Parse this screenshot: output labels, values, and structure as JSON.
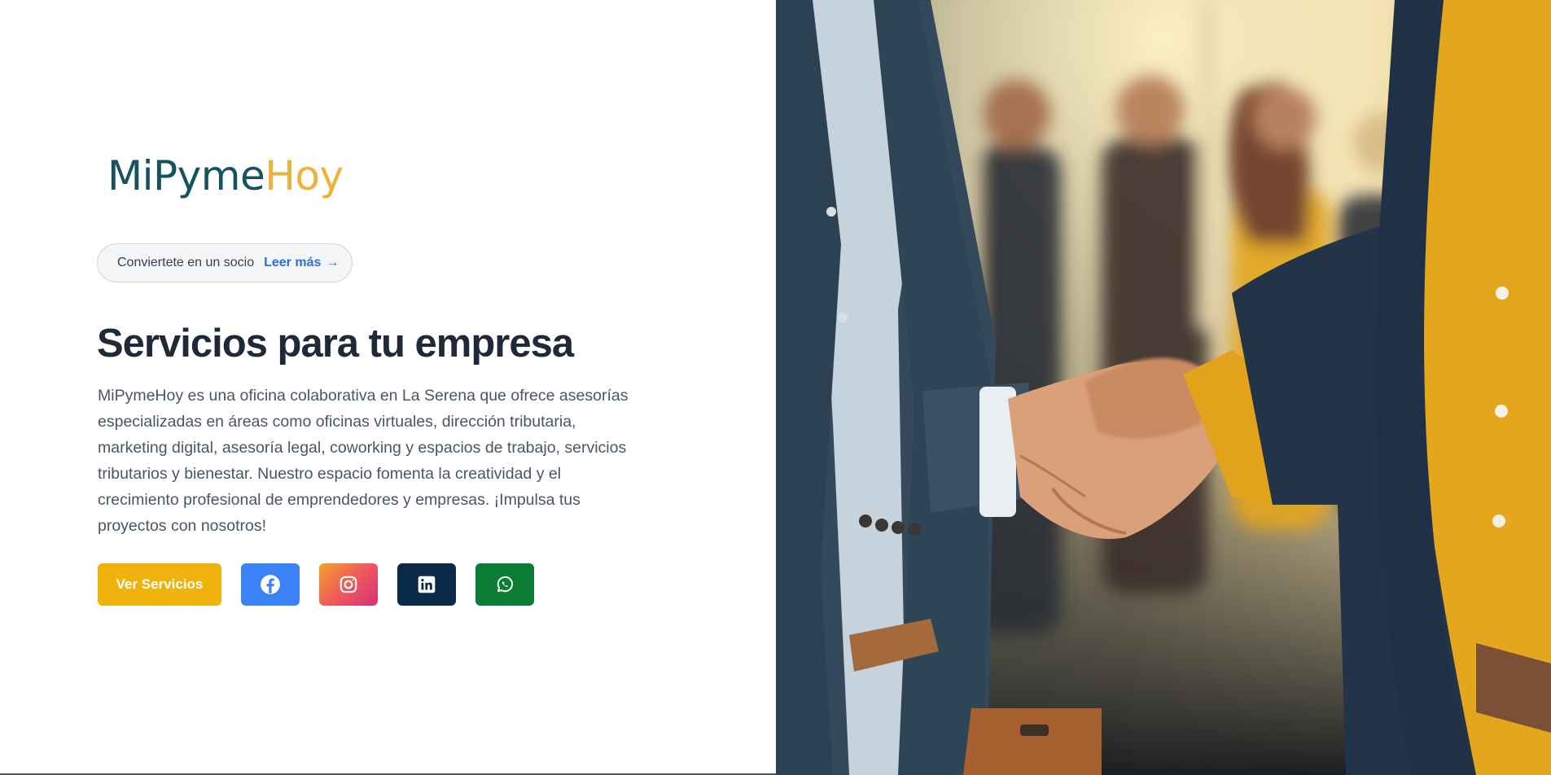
{
  "brand": {
    "logo_part1": "MiPyme",
    "logo_part2": "Hoy",
    "primary_color": "#17535e",
    "accent_color": "#eeb23a"
  },
  "announcement": {
    "text": "Conviertete en un socio",
    "link_label": "Leer más",
    "arrow": "→"
  },
  "hero": {
    "title": "Servicios para tu empresa",
    "description": "MiPymeHoy es una oficina colaborativa en La Serena que ofrece asesorías especializadas en áreas como oficinas virtuales, dirección tributaria, marketing digital, asesoría legal, coworking y espacios de trabajo, servicios tributarios y bienestar. Nuestro espacio fomenta la creatividad y el crecimiento profesional de emprendedores y empresas. ¡Impulsa tus proyectos con nosotros!",
    "cta_label": "Ver Servicios"
  },
  "social": [
    {
      "name": "facebook",
      "icon": "facebook-icon",
      "color": "#3b82f6"
    },
    {
      "name": "instagram",
      "icon": "instagram-icon",
      "color": "#e1306c"
    },
    {
      "name": "linkedin",
      "icon": "linkedin-icon",
      "color": "#0a2a4a"
    },
    {
      "name": "whatsapp",
      "icon": "whatsapp-icon",
      "color": "#0b7d34"
    }
  ],
  "image": {
    "subject": "handshake-photo"
  }
}
